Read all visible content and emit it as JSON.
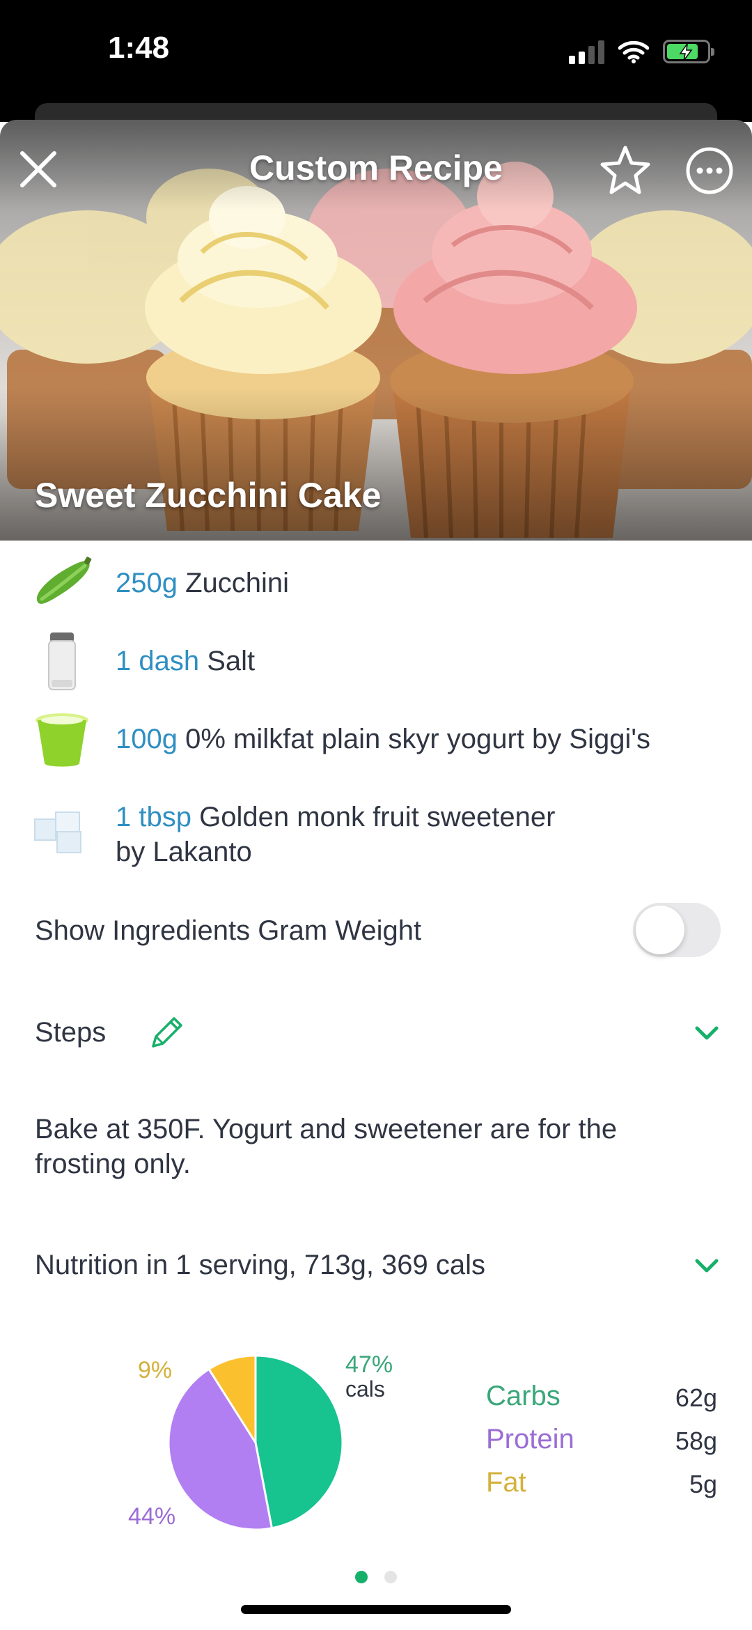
{
  "status_bar": {
    "time": "1:48"
  },
  "header": {
    "title": "Custom Recipe"
  },
  "recipe": {
    "name": "Sweet Zucchini Cake"
  },
  "ingredients": [
    {
      "qty": "250g",
      "name": "Zucchini",
      "icon": "zucchini-icon"
    },
    {
      "qty": "1 dash",
      "name": "Salt",
      "icon": "salt-shaker-icon"
    },
    {
      "qty": "100g",
      "name": "0% milkfat plain skyr yogurt by Siggi's",
      "icon": "yogurt-cup-icon"
    },
    {
      "qty": "1 tbsp",
      "name": "Golden monk fruit sweetener",
      "name_line2": "by Lakanto",
      "icon": "sugar-cubes-icon"
    }
  ],
  "gram_weight_toggle": {
    "label": "Show Ingredients Gram Weight",
    "on": false
  },
  "steps": {
    "title": "Steps",
    "text_line1": "Bake at 350F. Yogurt and sweetener are for the",
    "text_line2": "frosting only."
  },
  "nutrition": {
    "title": "Nutrition in 1 serving, 713g, 369 cals",
    "cals_label": "cals",
    "legend": [
      {
        "name": "Carbs",
        "value": "62g",
        "color": "#3aa77a"
      },
      {
        "name": "Protein",
        "value": "58g",
        "color": "#9b6dd6"
      },
      {
        "name": "Fat",
        "value": "5g",
        "color": "#d4b13c"
      }
    ]
  },
  "chart_data": {
    "type": "pie",
    "categories": [
      "Carbs",
      "Protein",
      "Fat"
    ],
    "values": [
      47,
      44,
      9
    ],
    "labels": [
      "47%",
      "44%",
      "9%"
    ],
    "colors": [
      "#17c38f",
      "#b17ff2",
      "#fbc02d"
    ]
  },
  "pagination": {
    "pages": 2,
    "active": 0
  },
  "colors": {
    "accent": "#17b06a",
    "quantity": "#2f8fc2"
  }
}
